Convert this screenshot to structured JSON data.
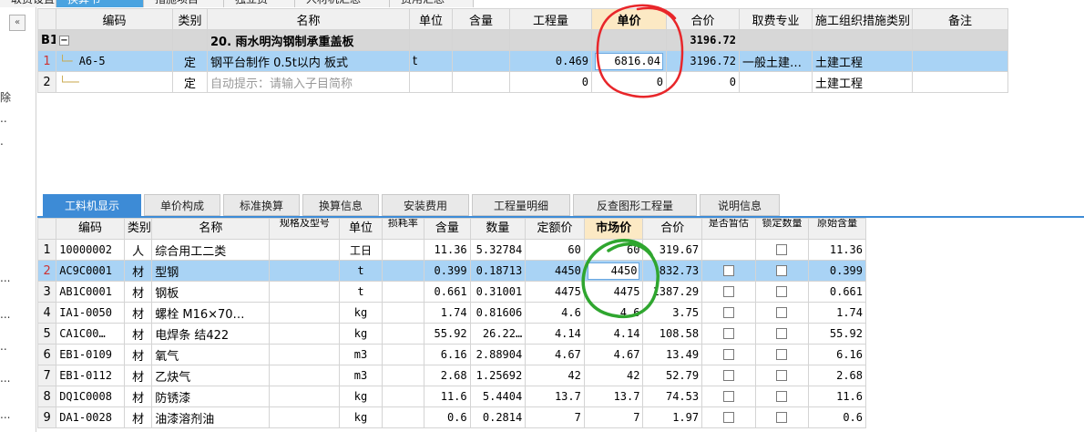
{
  "top_tabs": [
    {
      "label": "取费设置",
      "active": false
    },
    {
      "label": "换算书",
      "active": true
    },
    {
      "label": "措施项目",
      "active": false
    },
    {
      "label": "独立费",
      "active": false
    },
    {
      "label": "人材机汇总",
      "active": false
    },
    {
      "label": "费用汇总",
      "active": false
    }
  ],
  "left_strip": {
    "collapse_glyph": "«",
    "fragments": [
      "除",
      "..",
      ".",
      "...",
      "...",
      "..",
      "...",
      "..."
    ]
  },
  "upper": {
    "headers": [
      "",
      "编码",
      "类别",
      "名称",
      "单位",
      "含量",
      "工程量",
      "单价",
      "合价",
      "取费专业",
      "施工组织措施类别",
      "备注"
    ],
    "group_row": {
      "label": "B1",
      "toggle": "−",
      "name": "20. 雨水明沟钢制承重盖板",
      "total": "3196.72"
    },
    "rows": [
      {
        "num": "1",
        "code": "A6-5",
        "type": "定",
        "name": "钢平台制作 0.5t以内 板式",
        "unit": "t",
        "content": "",
        "qty": "0.469",
        "price": "6816.04",
        "total": "3196.72",
        "fee": "一般土建…",
        "org": "土建工程",
        "note": ""
      },
      {
        "num": "2",
        "code": "",
        "type": "定",
        "name": "自动提示：请输入子目简称",
        "unit": "",
        "content": "",
        "qty": "0",
        "price": "0",
        "total": "0",
        "fee": "",
        "org": "土建工程",
        "note": ""
      }
    ]
  },
  "lower_tabs": [
    {
      "label": "工料机显示",
      "active": true
    },
    {
      "label": "单价构成",
      "active": false
    },
    {
      "label": "标准换算",
      "active": false
    },
    {
      "label": "换算信息",
      "active": false
    },
    {
      "label": "安装费用",
      "active": false
    },
    {
      "label": "工程量明细",
      "active": false
    },
    {
      "label": "反查图形工程量",
      "active": false
    },
    {
      "label": "说明信息",
      "active": false
    }
  ],
  "lower": {
    "headers": [
      "",
      "编码",
      "类别",
      "名称",
      "规格及型号",
      "单位",
      "损耗率",
      "含量",
      "数量",
      "定额价",
      "市场价",
      "合价",
      "是否暂估",
      "锁定数量",
      "原始含量"
    ],
    "rows": [
      {
        "num": "1",
        "code": "10000002",
        "type": "人",
        "name": "综合用工二类",
        "spec": "",
        "unit": "工日",
        "loss": "",
        "content": "11.36",
        "qty": "5.32784",
        "quota": "60",
        "market": "60",
        "total": "319.67",
        "est": false,
        "lock": true,
        "orig": "11.36"
      },
      {
        "num": "2",
        "code": "AC9C0001",
        "type": "材",
        "name": "型钢",
        "spec": "",
        "unit": "t",
        "loss": "",
        "content": "0.399",
        "qty": "0.18713",
        "quota": "4450",
        "market": "4450",
        "total": "832.73",
        "est": true,
        "lock": true,
        "orig": "0.399"
      },
      {
        "num": "3",
        "code": "AB1C0001",
        "type": "材",
        "name": "钢板",
        "spec": "",
        "unit": "t",
        "loss": "",
        "content": "0.661",
        "qty": "0.31001",
        "quota": "4475",
        "market": "4475",
        "total": "1387.29",
        "est": true,
        "lock": true,
        "orig": "0.661"
      },
      {
        "num": "4",
        "code": "IA1-0050",
        "type": "材",
        "name": "螺栓 M16×70…",
        "spec": "",
        "unit": "kg",
        "loss": "",
        "content": "1.74",
        "qty": "0.81606",
        "quota": "4.6",
        "market": "4.6",
        "total": "3.75",
        "est": true,
        "lock": true,
        "orig": "1.74"
      },
      {
        "num": "5",
        "code": "CA1C00…",
        "type": "材",
        "name": "电焊条 结422",
        "spec": "",
        "unit": "kg",
        "loss": "",
        "content": "55.92",
        "qty": "26.22…",
        "quota": "4.14",
        "market": "4.14",
        "total": "108.58",
        "est": true,
        "lock": true,
        "orig": "55.92"
      },
      {
        "num": "6",
        "code": "EB1-0109",
        "type": "材",
        "name": "氧气",
        "spec": "",
        "unit": "m3",
        "loss": "",
        "content": "6.16",
        "qty": "2.88904",
        "quota": "4.67",
        "market": "4.67",
        "total": "13.49",
        "est": true,
        "lock": true,
        "orig": "6.16"
      },
      {
        "num": "7",
        "code": "EB1-0112",
        "type": "材",
        "name": "乙炔气",
        "spec": "",
        "unit": "m3",
        "loss": "",
        "content": "2.68",
        "qty": "1.25692",
        "quota": "42",
        "market": "42",
        "total": "52.79",
        "est": true,
        "lock": true,
        "orig": "2.68"
      },
      {
        "num": "8",
        "code": "DQ1C0008",
        "type": "材",
        "name": "防锈漆",
        "spec": "",
        "unit": "kg",
        "loss": "",
        "content": "11.6",
        "qty": "5.4404",
        "quota": "13.7",
        "market": "13.7",
        "total": "74.53",
        "est": true,
        "lock": true,
        "orig": "11.6"
      },
      {
        "num": "9",
        "code": "DA1-0028",
        "type": "材",
        "name": "油漆溶剂油",
        "spec": "",
        "unit": "kg",
        "loss": "",
        "content": "0.6",
        "qty": "0.2814",
        "quota": "7",
        "market": "7",
        "total": "1.97",
        "est": true,
        "lock": true,
        "orig": "0.6"
      }
    ]
  },
  "colors": {
    "accent": "#3d8bd6",
    "selected_row": "#a9d3f5",
    "header_highlight": "#fce9c4",
    "group_row": "#d7d7d7",
    "red_annotation": "#e8262a",
    "green_annotation": "#2fa62f"
  }
}
